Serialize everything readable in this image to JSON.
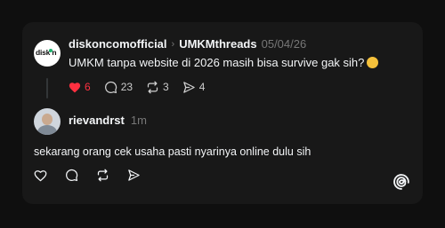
{
  "post": {
    "author": "diskoncomofficial",
    "avatar_text": "disk n",
    "separator_icon": "chevron-right-icon",
    "reply_to": "UMKMthreads",
    "timestamp": "05/04/26",
    "text": "UMKM tanpa website di 2026 masih bisa survive gak sih?",
    "emoji_icon": "thinking-face-icon",
    "likes": "6",
    "comments": "23",
    "reposts": "3",
    "shares": "4",
    "like_color": "#ff3040"
  },
  "reply": {
    "author": "rievandrst",
    "timestamp": "1m",
    "text": "sekarang orang cek usaha pasti nyarinya online dulu sih"
  },
  "brand": {
    "logo_icon": "threads-logo-icon"
  }
}
